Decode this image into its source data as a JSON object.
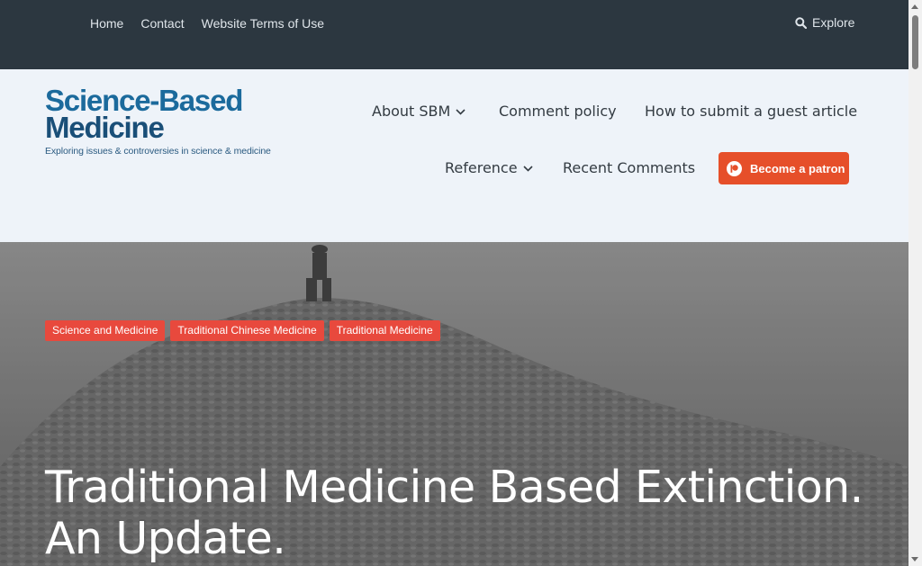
{
  "topbar": {
    "links": [
      "Home",
      "Contact",
      "Website Terms of Use"
    ],
    "explore_label": "Explore",
    "search_icon": "search-icon"
  },
  "logo": {
    "line1": "Science-Based",
    "line2": "Medicine",
    "tagline": "Exploring issues & controversies in science & medicine"
  },
  "mainnav": {
    "about": "About SBM",
    "comment_policy": "Comment policy",
    "guest_article": "How to submit a guest article",
    "reference": "Reference",
    "recent_comments": "Recent Comments",
    "patron_label": "Become a patron"
  },
  "hero": {
    "categories": [
      "Science and Medicine",
      "Traditional Chinese Medicine",
      "Traditional Medicine"
    ],
    "title": "Traditional Medicine Based Extinction. An Update."
  },
  "colors": {
    "topbar": "#2c3740",
    "header_bg": "#eef3f9",
    "category_badge": "#e8493d",
    "patron_button": "#e64f2a",
    "logo_blue": "#1b6a9c"
  }
}
